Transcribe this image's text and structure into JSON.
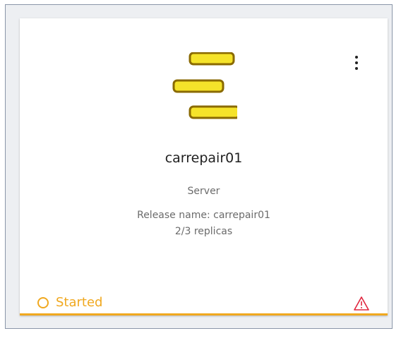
{
  "card": {
    "title": "carrepair01",
    "type": "Server",
    "release": "Release name: carrepair01",
    "replicas": "2/3 replicas",
    "status": "Started",
    "logo_icon": "stacked-bars-logo-icon",
    "menu_icon": "kebab-menu-icon",
    "warning_icon": "warning-triangle-icon"
  },
  "colors": {
    "accent": "#f0a81f",
    "warning": "#e0263f",
    "logo_fill": "#f5e32a",
    "logo_stroke": "#8a6a00"
  }
}
